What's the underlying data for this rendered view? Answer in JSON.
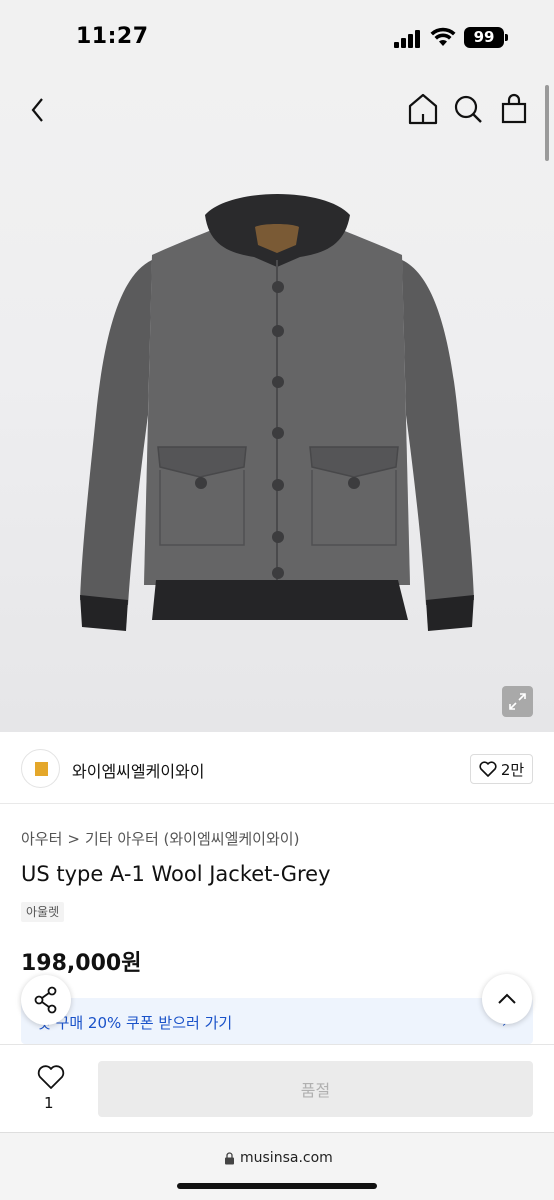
{
  "status_bar": {
    "time": "11:27",
    "battery": "99"
  },
  "nav": {
    "back_icon": "chevron-left-icon",
    "home_icon": "home-icon",
    "search_icon": "search-icon",
    "cart_icon": "shopping-bag-icon"
  },
  "store": {
    "name": "와이엠씨엘케이와이",
    "like_count": "2만"
  },
  "breadcrumb": {
    "category": "아우터",
    "separator": ">",
    "subcategory": "기타 아우터 (와이엠씨엘케이와이)"
  },
  "product": {
    "title": "US type A-1 Wool Jacket-Grey",
    "tag": "아울렛",
    "price": "198,000원"
  },
  "coupon": {
    "text": "첫 구매 20% 쿠폰 받으러 가기",
    "chevron": "›"
  },
  "bottom_bar": {
    "like_count": "1",
    "soldout_label": "품절"
  },
  "url_bar": {
    "url": "musinsa.com"
  },
  "colors": {
    "accent_blue": "#1a52c9",
    "coupon_bg": "#eef4fd",
    "disabled_bg": "#ebebeb"
  }
}
